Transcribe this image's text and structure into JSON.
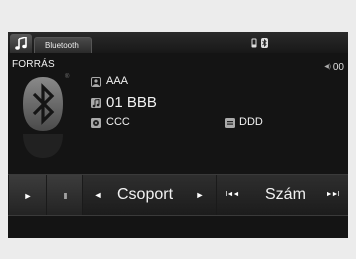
{
  "tabs": {
    "music_icon": "music-note-icon",
    "bluetooth_tab": "Bluetooth"
  },
  "status": {
    "phone_icon": "phone-icon",
    "bluetooth_icon": "bluetooth-icon"
  },
  "source": {
    "label": "FORRÁS"
  },
  "volume": {
    "value": "00"
  },
  "track_info": {
    "artist": "AAA",
    "track": "01 BBB",
    "album": "CCC",
    "genre": "DDD"
  },
  "controls": {
    "play_symbol": "►",
    "pause_symbol": "II",
    "group_label": "Csoport",
    "group_prev": "◄",
    "group_next": "►",
    "track_label": "Szám",
    "track_prev": "I◄◄",
    "track_next": "►►I"
  },
  "colors": {
    "screen_bg": "#141414",
    "text": "#f2f2f2",
    "frame_bg": "#ececec"
  }
}
